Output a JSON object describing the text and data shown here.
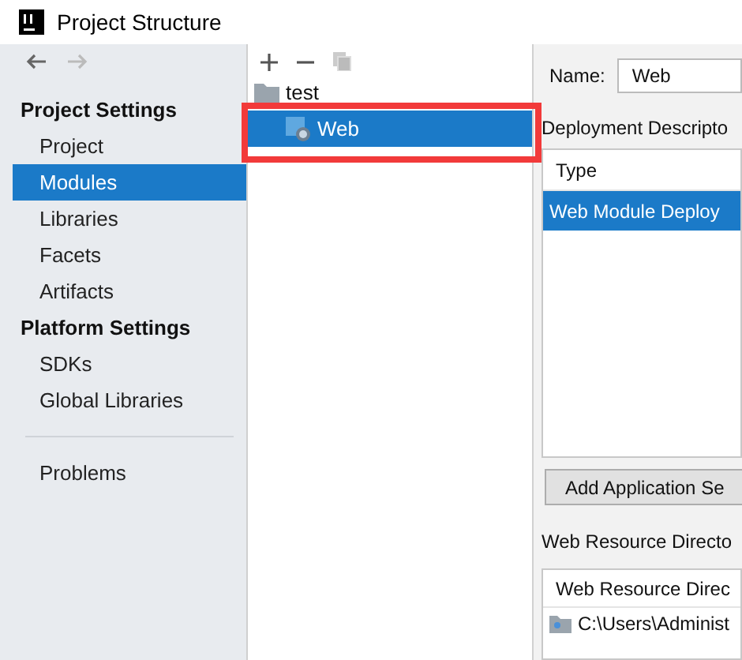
{
  "window": {
    "title": "Project Structure"
  },
  "sidebar": {
    "sections": [
      {
        "heading": "Project Settings",
        "items": [
          {
            "label": "Project",
            "selected": false
          },
          {
            "label": "Modules",
            "selected": true
          },
          {
            "label": "Libraries",
            "selected": false
          },
          {
            "label": "Facets",
            "selected": false
          },
          {
            "label": "Artifacts",
            "selected": false
          }
        ]
      },
      {
        "heading": "Platform Settings",
        "items": [
          {
            "label": "SDKs",
            "selected": false
          },
          {
            "label": "Global Libraries",
            "selected": false
          }
        ]
      }
    ],
    "footer_items": [
      {
        "label": "Problems",
        "selected": false
      }
    ]
  },
  "tree": {
    "items": [
      {
        "label": "test",
        "selected": false,
        "children": [
          {
            "label": "Web",
            "selected": true
          }
        ]
      }
    ]
  },
  "details": {
    "name_label": "Name:",
    "name_value": "Web",
    "deployment_label": "Deployment Descripto",
    "deployment_table": {
      "columns": [
        "Type"
      ],
      "rows": [
        {
          "cells": [
            "Web Module Deploy"
          ],
          "selected": true
        }
      ]
    },
    "add_button": "Add Application Se",
    "resource_label": "Web Resource Directo",
    "resource_table": {
      "columns": [
        "Web Resource Direc"
      ],
      "rows": [
        {
          "cells": [
            "C:\\Users\\Administ"
          ],
          "selected": false
        }
      ]
    }
  }
}
